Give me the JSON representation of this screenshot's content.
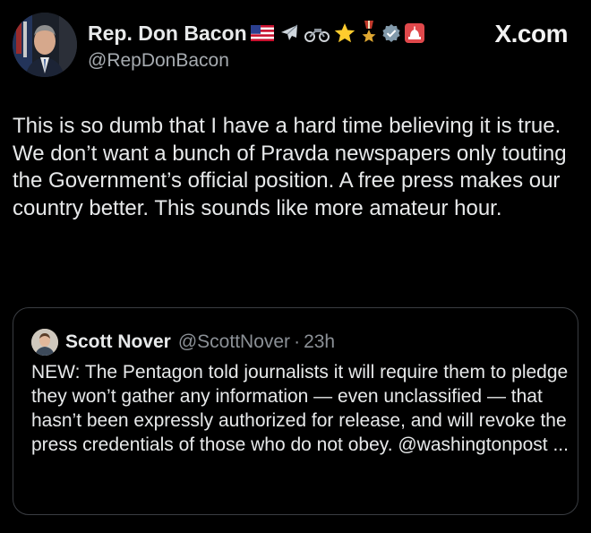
{
  "brand": "X.com",
  "author": {
    "display_name": "Rep. Don Bacon",
    "handle": "@RepDonBacon",
    "badges": [
      "us-flag-icon",
      "airplane-icon",
      "motorcycle-icon",
      "star-icon",
      "medal-icon",
      "verified-icon",
      "capitol-icon"
    ]
  },
  "tweet": {
    "text": "This is so dumb that I have a hard time believing it is true. We don’t want a bunch of Pravda newspapers only touting the Government’s official position. A free press makes our country better. This sounds like more amateur hour."
  },
  "quote": {
    "display_name": "Scott Nover",
    "handle": "@ScottNover",
    "separator": "·",
    "time": "23h",
    "text": "NEW: The Pentagon told journalists it will require them to pledge they won’t gather any information — even unclassified — that hasn’t been expressly authorized for release, and will revoke the press credentials of those who do not obey. @washingtonpost ..."
  },
  "colors": {
    "background": "#000000",
    "text": "#e7e9ea",
    "secondary_text": "#8b9096",
    "verified": "#829aab",
    "border": "#3a3d42"
  }
}
